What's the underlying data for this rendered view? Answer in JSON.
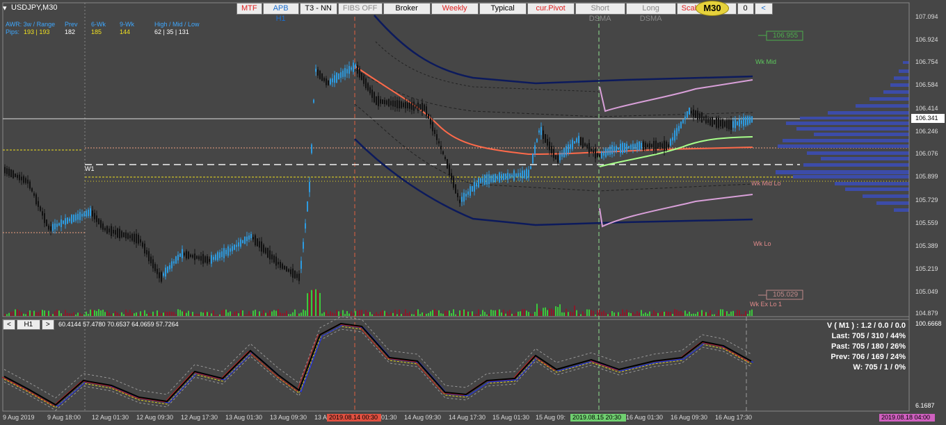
{
  "symbol_title": "USDJPY,M30",
  "toolbar": {
    "buttons": [
      {
        "label": "MTF",
        "color": "#e02020"
      },
      {
        "label": "APB H1",
        "color": "#1a6fd0"
      },
      {
        "label": "T3 - NN",
        "color": "#000000"
      },
      {
        "label": "FIBS OFF",
        "color": "#888888"
      },
      {
        "label": "Broker",
        "color": "#000000"
      },
      {
        "label": "Weekly",
        "color": "#e02020"
      },
      {
        "label": "Typical",
        "color": "#000000"
      },
      {
        "label": "cur.Pivot",
        "color": "#e02020"
      },
      {
        "label": "Short DSMA",
        "color": "#888888"
      },
      {
        "label": "Long DSMA",
        "color": "#888888"
      },
      {
        "label": "Scale F",
        "color": "#e02020"
      }
    ],
    "tf_badge": "M30",
    "tf_badge_tail": "0",
    "back_button": "<"
  },
  "info": {
    "awr_label": "AWR: 3w / Range",
    "prev_label": "Prev",
    "sixwk_label": "6-Wk",
    "ninewk_label": "9-Wk",
    "hml_label": "High / Mid / Low",
    "pips_label": "Pips:",
    "awr_values": "193 | 193",
    "prev_value": "182",
    "sixwk_value": "185",
    "ninewk_value": "144",
    "hml_values": "62  |  35  |  131"
  },
  "levels": {
    "wk_mid": "Wk Mid",
    "wk_mid_lo": "Wk Mid Lo",
    "wk_lo": "Wk Lo",
    "wk_ex_lo": "Wk Ex Lo 1",
    "w1": "W1",
    "box_high": "106.955",
    "box_low": "105.029"
  },
  "price_axis": [
    "107.094",
    "106.924",
    "106.754",
    "106.584",
    "106.414",
    "106.246",
    "106.076",
    "105.899",
    "105.729",
    "105.559",
    "105.389",
    "105.219",
    "105.049",
    "104.879"
  ],
  "current_price": "106.341",
  "date_axis": [
    "9 Aug 2019",
    "9 Aug 18:00",
    "12 Aug 01:30",
    "12 Aug 09:30",
    "12 Aug 17:30",
    "13 Aug 01:30",
    "13 Aug 09:30",
    "13 A",
    "01:30",
    "14 Aug 09:30",
    "14 Aug 17:30",
    "15 Aug 01:30",
    "15 Aug 09:",
    "16 Aug 01:30",
    "16 Aug 09:30",
    "16 Aug 17:30"
  ],
  "date_markers": {
    "red": "2019.08.14 00:30",
    "green": "2019.08.15 20:30",
    "right": "2019.08.18 04:00"
  },
  "indicator": {
    "prev_btn": "<",
    "tf_btn": "H1",
    "next_btn": ">",
    "values": "60.4144 57.4780 70.6537 64.0659 57.7264",
    "axis_top": "100.6668",
    "axis_bottom": "6.1687"
  },
  "stats": {
    "line1": "V ( M1 ) : 1.2 / 0.0 / 0.0",
    "line2": "Last: 705 / 310 / 44%",
    "line3": "Past: 705 / 180 / 26%",
    "line4": "Prev: 706 / 169 / 24%",
    "line5": "W: 705 / 1 / 0%"
  }
}
